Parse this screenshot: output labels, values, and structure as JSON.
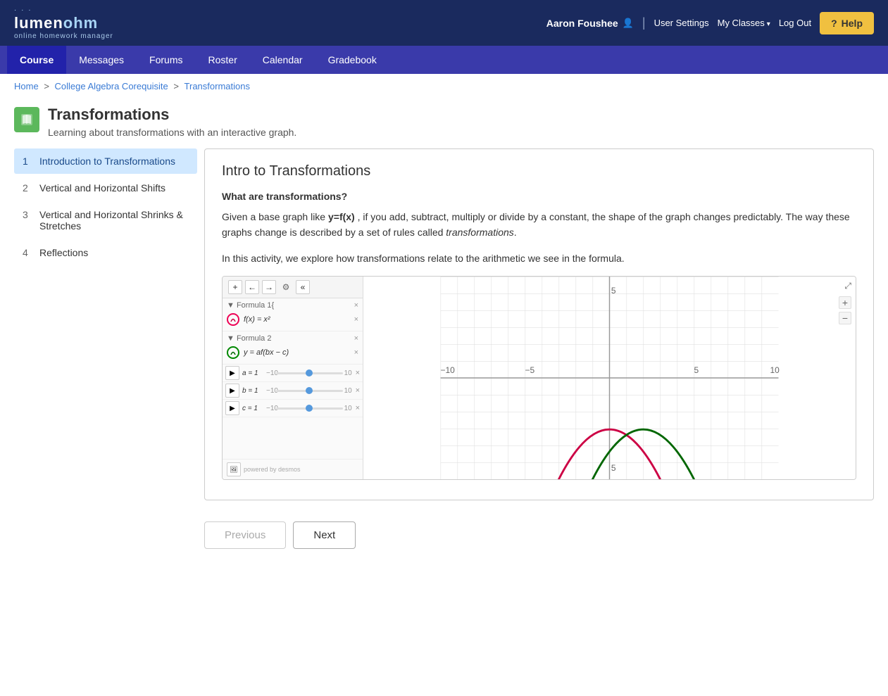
{
  "header": {
    "logo_lumen": "lumen",
    "logo_ohm": "ohm",
    "logo_subtitle": "online homework manager",
    "user_name": "Aaron Foushee",
    "user_settings_label": "User Settings",
    "my_classes_label": "My Classes",
    "logout_label": "Log Out",
    "help_label": "Help"
  },
  "nav": {
    "items": [
      {
        "label": "Course",
        "active": true
      },
      {
        "label": "Messages",
        "active": false
      },
      {
        "label": "Forums",
        "active": false
      },
      {
        "label": "Roster",
        "active": false
      },
      {
        "label": "Calendar",
        "active": false
      },
      {
        "label": "Gradebook",
        "active": false
      }
    ]
  },
  "breadcrumb": {
    "items": [
      "Home",
      "College Algebra Corequisite",
      "Transformations"
    ]
  },
  "page": {
    "title": "Transformations",
    "subtitle": "Learning about transformations with an interactive graph."
  },
  "sidebar": {
    "items": [
      {
        "number": "1",
        "label": "Introduction to Transformations",
        "active": true
      },
      {
        "number": "2",
        "label": "Vertical and Horizontal Shifts",
        "active": false
      },
      {
        "number": "3",
        "label": "Vertical and Horizontal Shrinks & Stretches",
        "active": false
      },
      {
        "number": "4",
        "label": "Reflections",
        "active": false
      }
    ]
  },
  "content": {
    "title": "Intro to Transformations",
    "section_title": "What are transformations?",
    "paragraph1": "Given a base graph like y=f(x) , if you add, subtract, multiply or divide by a constant, the shape of the graph changes predictably. The way these graphs change is described by a set of rules called transformations.",
    "paragraph1_bold": "y=f(x)",
    "paragraph1_italic": "transformations",
    "paragraph2": "In this activity, we explore how transformations relate to the arithmetic we see in the formula.",
    "graph": {
      "formula1_label": "Formula 1{",
      "formula1_expr": "f(x) = x²",
      "formula2_label": "Formula 2",
      "formula2_expr": "y = af(bx − c)",
      "slider_a": "a = 1",
      "slider_b": "b = 1",
      "slider_c": "c = 1",
      "slider_min": "−10",
      "slider_max": "10",
      "powered_by": "powered by desmos"
    }
  },
  "buttons": {
    "previous_label": "Previous",
    "next_label": "Next"
  }
}
